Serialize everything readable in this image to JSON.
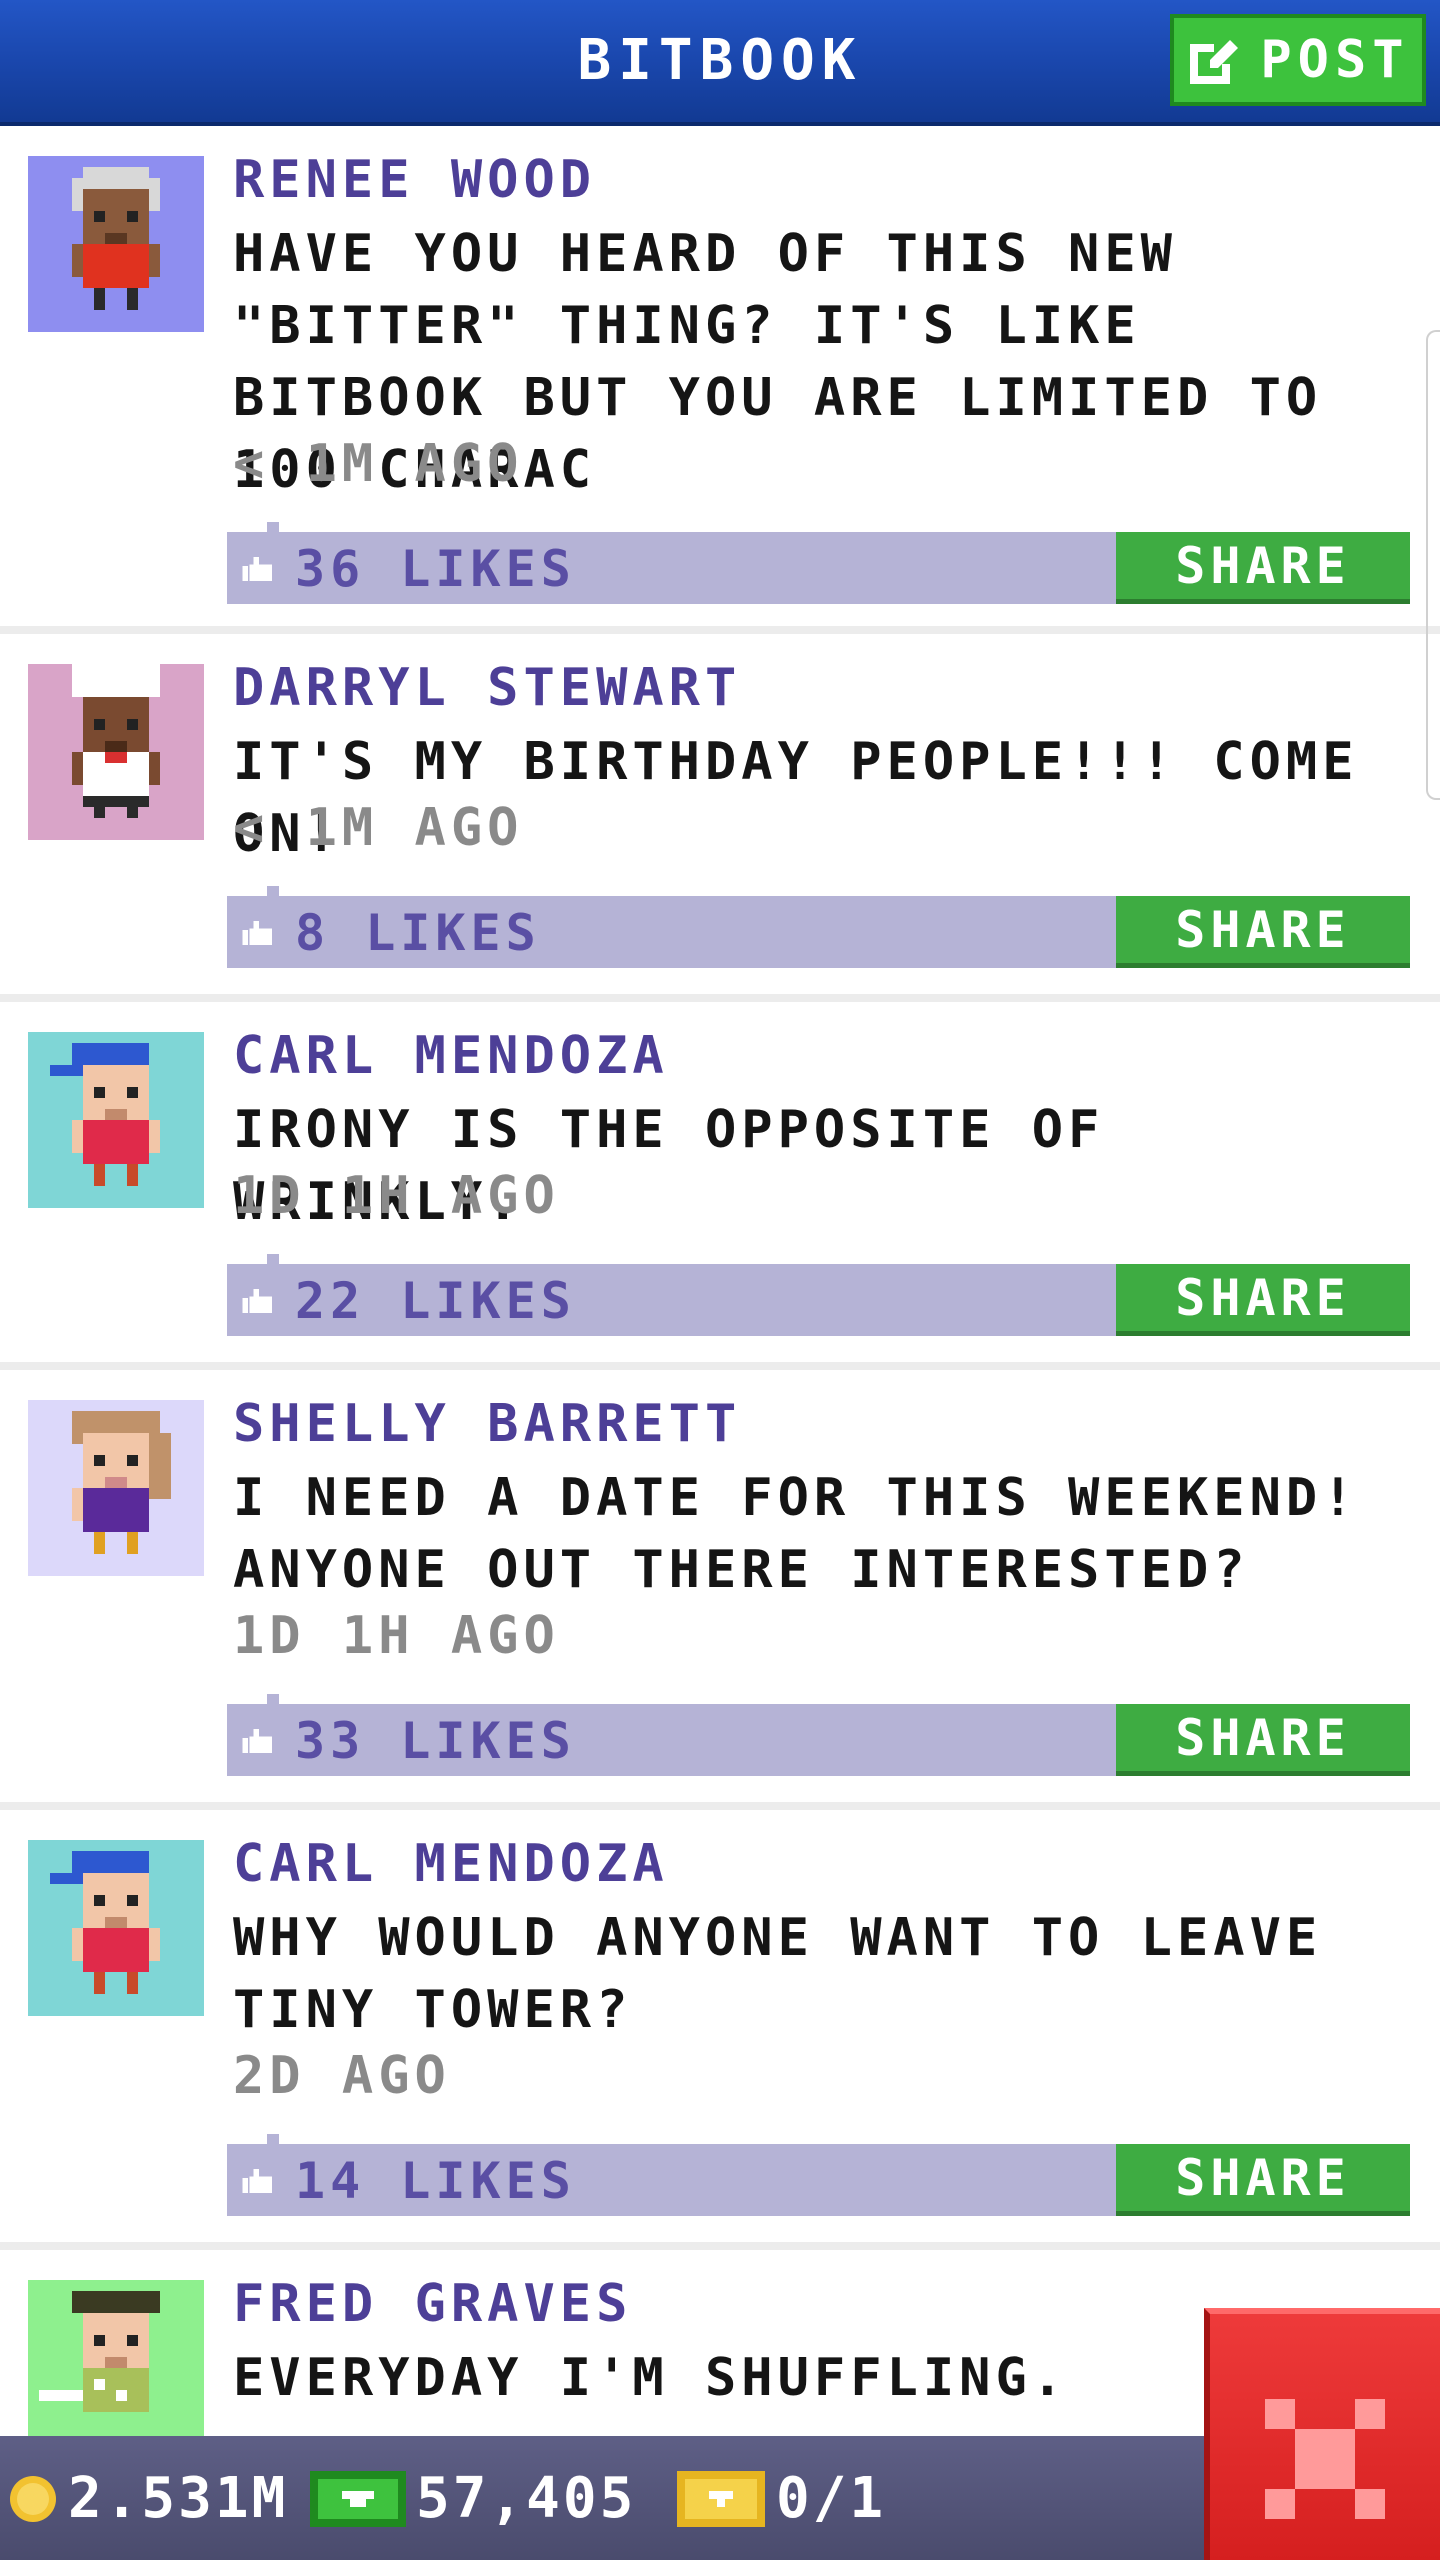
{
  "header": {
    "title": "BITBOOK",
    "post_label": "POST"
  },
  "posts": [
    {
      "author": "RENEE WOOD",
      "message": "HAVE YOU HEARD OF THIS NEW \"BITTER\" THING? IT'S LIKE BITBOOK BUT YOU ARE LIMITED TO 100 CHARAC",
      "time": "< 1M AGO",
      "likes": "36 LIKES",
      "share": "SHARE",
      "avatar_color": "#8e8ef0"
    },
    {
      "author": "DARRYL STEWART",
      "message": "IT'S MY BIRTHDAY PEOPLE!!! COME ON!",
      "time": "< 1M AGO",
      "likes": "8 LIKES",
      "share": "SHARE",
      "avatar_color": "#d9a4c8"
    },
    {
      "author": "CARL MENDOZA",
      "message": "IRONY IS THE OPPOSITE OF WRINKLY.",
      "time": "1D 1H AGO",
      "likes": "22 LIKES",
      "share": "SHARE",
      "avatar_color": "#7fd6d6"
    },
    {
      "author": "SHELLY BARRETT",
      "message": "I NEED A DATE FOR THIS WEEKEND! ANYONE OUT THERE INTERESTED?",
      "time": "1D 1H AGO",
      "likes": "33 LIKES",
      "share": "SHARE",
      "avatar_color": "#dcd8fa"
    },
    {
      "author": "CARL MENDOZA",
      "message": "WHY WOULD ANYONE WANT TO LEAVE TINY TOWER?",
      "time": "2D AGO",
      "likes": "14 LIKES",
      "share": "SHARE",
      "avatar_color": "#7fd6d6"
    },
    {
      "author": "FRED GRAVES",
      "message": "EVERYDAY I'M SHUFFLING.",
      "avatar_color": "#8ef08e"
    }
  ],
  "footer": {
    "coins": "2.531M",
    "bux": "57,405",
    "tickets": "0/1"
  },
  "colors": {
    "header_blue": "#1a47ad",
    "author_purple": "#4d3f97",
    "share_green": "#3eac42",
    "like_bar": "#b5b3d6",
    "close_red": "#e02a2a"
  }
}
